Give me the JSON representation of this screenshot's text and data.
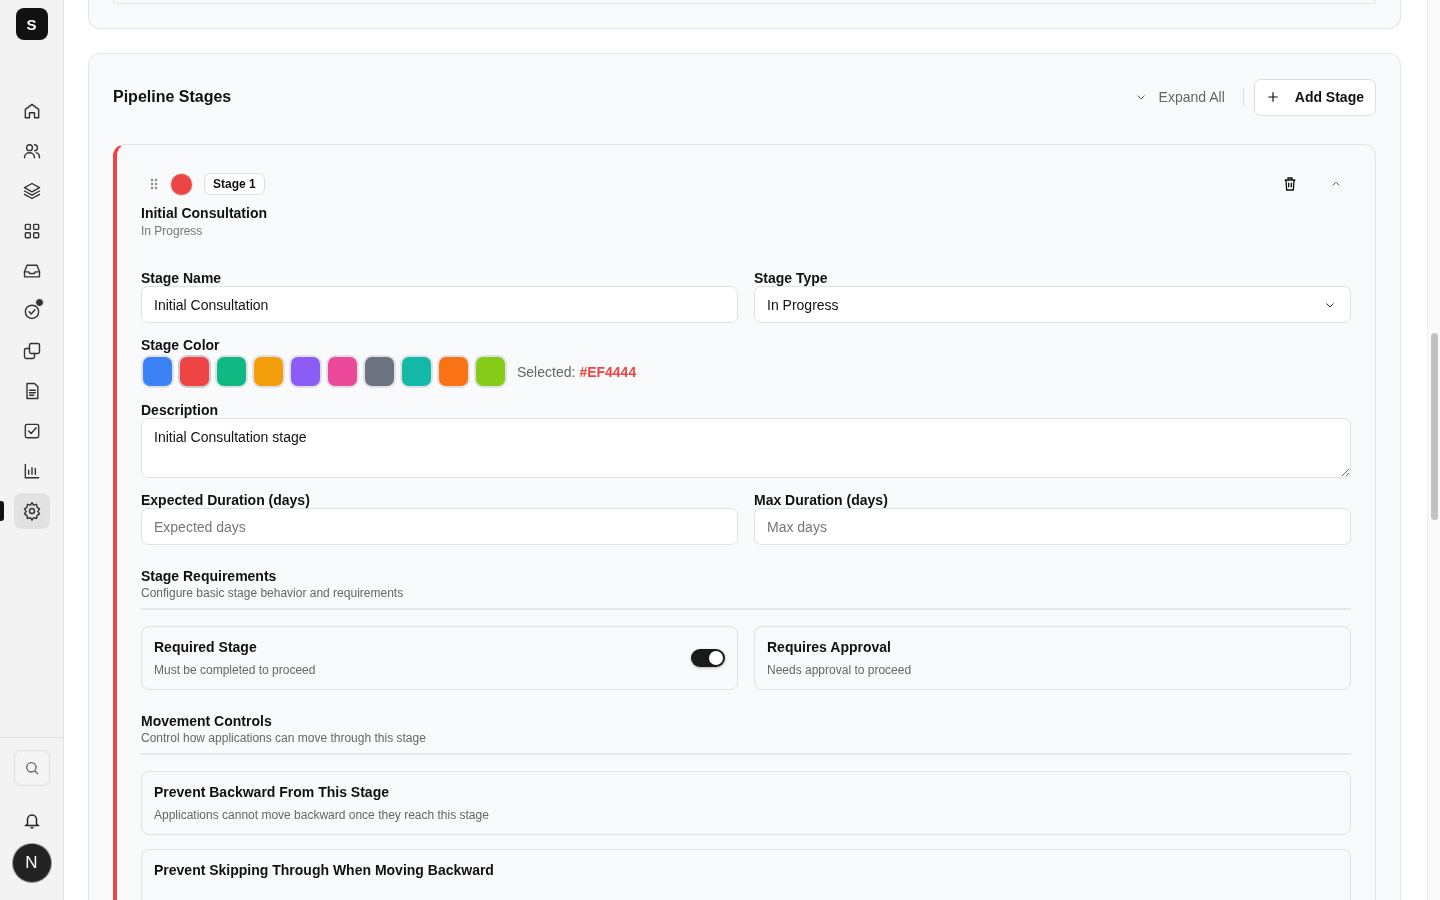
{
  "sidebar": {
    "logo": "S",
    "items": [
      {
        "selected": false,
        "dot": false
      },
      {
        "selected": false,
        "dot": false
      },
      {
        "selected": false,
        "dot": false
      },
      {
        "selected": false,
        "dot": false
      },
      {
        "selected": false,
        "dot": false
      },
      {
        "selected": false,
        "dot": true
      },
      {
        "selected": false,
        "dot": false
      },
      {
        "selected": false,
        "dot": false
      },
      {
        "selected": false,
        "dot": false
      },
      {
        "selected": false,
        "dot": false
      },
      {
        "selected": true,
        "dot": false
      }
    ],
    "avatar": "N"
  },
  "pipeline": {
    "title": "Pipeline Stages",
    "expand_all": "Expand All",
    "add_stage": "Add Stage",
    "stage": {
      "color": "#ef4444",
      "badge": "Stage 1",
      "name": "Initial Consultation",
      "type": "In Progress",
      "fields": {
        "name_label": "Stage Name",
        "name_value": "Initial Consultation",
        "type_label": "Stage Type",
        "type_value": "In Progress",
        "color_label": "Stage Color",
        "swatches": [
          {
            "color": "#3b82f6",
            "selected": false
          },
          {
            "color": "#ef4444",
            "selected": true
          },
          {
            "color": "#10b981",
            "selected": false
          },
          {
            "color": "#f59e0b",
            "selected": false
          },
          {
            "color": "#8b5cf6",
            "selected": false
          },
          {
            "color": "#ec4899",
            "selected": false
          },
          {
            "color": "#6b7280",
            "selected": false
          },
          {
            "color": "#14b8a6",
            "selected": false
          },
          {
            "color": "#f97316",
            "selected": false
          },
          {
            "color": "#84cc16",
            "selected": false
          }
        ],
        "selected_label": "Selected:",
        "selected_value": "#EF4444",
        "description_label": "Description",
        "description_value": "Initial Consultation stage",
        "expected_label": "Expected Duration (days)",
        "expected_placeholder": "Expected days",
        "max_label": "Max Duration (days)",
        "max_placeholder": "Max days"
      },
      "sections": [
        {
          "kind": "grid",
          "title": "Stage Requirements",
          "subtitle": "Configure basic stage behavior and requirements",
          "options": [
            {
              "title": "Required Stage",
              "text": "Must be completed to proceed",
              "on": true
            },
            {
              "title": "Requires Approval",
              "text": "Needs approval to proceed"
            }
          ]
        },
        {
          "kind": "list",
          "title": "Movement Controls",
          "subtitle": "Control how applications can move through this stage",
          "options": [
            {
              "title": "Prevent Backward From This Stage",
              "text": "Applications cannot move backward once they reach this stage"
            },
            {
              "title": "Prevent Skipping Through When Moving Backward"
            }
          ]
        }
      ]
    }
  }
}
